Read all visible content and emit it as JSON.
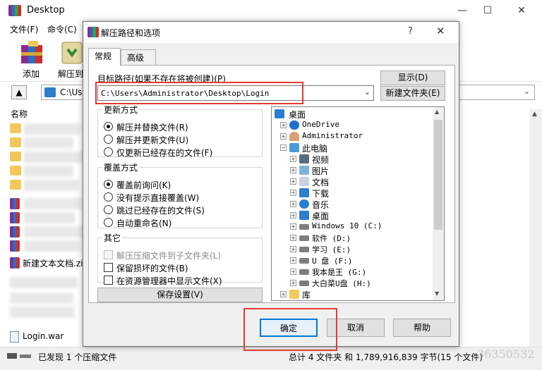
{
  "main": {
    "title": "Desktop",
    "menu": [
      "文件(F)",
      "命令(C)"
    ],
    "toolbar": [
      {
        "label": "添加",
        "icon": "rar-books-icon"
      },
      {
        "label": "解压到",
        "icon": "extract-to-icon"
      }
    ],
    "address": "C:\\Use",
    "file_list": {
      "column_name": "名称",
      "visible_files": [
        "新建文本文档.zip",
        "Login.war"
      ]
    },
    "status": {
      "left": "已发现 1 个压缩文件",
      "right": "总计 4 文件夹 和 1,789,916,839 字节(15 个文件)"
    },
    "watermark": "36350532"
  },
  "dialog": {
    "title": "解压路径和选项",
    "help_glyph": "?",
    "tabs": [
      "常规",
      "高级"
    ],
    "dest_label": "目标路径(如果不存在将被创建)(P)",
    "dest_value": "C:\\Users\\Administrator\\Desktop\\Login",
    "btn_show": "显示(D)",
    "btn_new_folder": "新建文件夹(E)",
    "update_mode": {
      "title": "更新方式",
      "options": [
        {
          "label": "解压并替换文件(R)",
          "selected": true
        },
        {
          "label": "解压并更新文件(U)",
          "selected": false
        },
        {
          "label": "仅更新已经存在的文件(F)",
          "selected": false
        }
      ]
    },
    "overwrite_mode": {
      "title": "覆盖方式",
      "options": [
        {
          "label": "覆盖前询问(K)",
          "selected": true
        },
        {
          "label": "没有提示直接覆盖(W)",
          "selected": false
        },
        {
          "label": "跳过已经存在的文件(S)",
          "selected": false
        },
        {
          "label": "自动重命名(N)",
          "selected": false
        }
      ]
    },
    "other": {
      "title": "其它",
      "options": [
        {
          "label": "解压压缩文件到子文件夹(L)",
          "checked": false,
          "disabled": true
        },
        {
          "label": "保留损坏的文件(B)",
          "checked": false,
          "disabled": false
        },
        {
          "label": "在资源管理器中显示文件(X)",
          "checked": false,
          "disabled": false
        }
      ]
    },
    "btn_save": "保存设置(V)",
    "tree": [
      {
        "label": "桌面",
        "level": 0,
        "icon": "desktop-icon"
      },
      {
        "label": "OneDrive",
        "level": 1,
        "icon": "cloud-icon"
      },
      {
        "label": "Administrator",
        "level": 1,
        "icon": "user-icon"
      },
      {
        "label": "此电脑",
        "level": 1,
        "icon": "computer-icon"
      },
      {
        "label": "视频",
        "level": 2,
        "icon": "video-icon"
      },
      {
        "label": "图片",
        "level": 2,
        "icon": "picture-icon"
      },
      {
        "label": "文档",
        "level": 2,
        "icon": "document-icon"
      },
      {
        "label": "下载",
        "level": 2,
        "icon": "download-icon"
      },
      {
        "label": "音乐",
        "level": 2,
        "icon": "music-icon"
      },
      {
        "label": "桌面",
        "level": 2,
        "icon": "desktop-icon"
      },
      {
        "label": "Windows 10 (C:)",
        "level": 2,
        "icon": "drive-icon"
      },
      {
        "label": "软件 (D:)",
        "level": 2,
        "icon": "drive-icon"
      },
      {
        "label": "学习 (E:)",
        "level": 2,
        "icon": "drive-icon"
      },
      {
        "label": "U 盘 (F:)",
        "level": 2,
        "icon": "drive-icon"
      },
      {
        "label": "我本是王 (G:)",
        "level": 2,
        "icon": "drive-icon"
      },
      {
        "label": "大白菜U盘 (H:)",
        "level": 2,
        "icon": "drive-icon"
      },
      {
        "label": "库",
        "level": 1,
        "icon": "library-icon"
      }
    ],
    "btn_ok": "确定",
    "btn_cancel": "取消",
    "btn_help": "帮助"
  },
  "colors": {
    "highlight": "#e53935",
    "accent": "#0078d7",
    "dialog_bg": "#f0f0f0"
  }
}
